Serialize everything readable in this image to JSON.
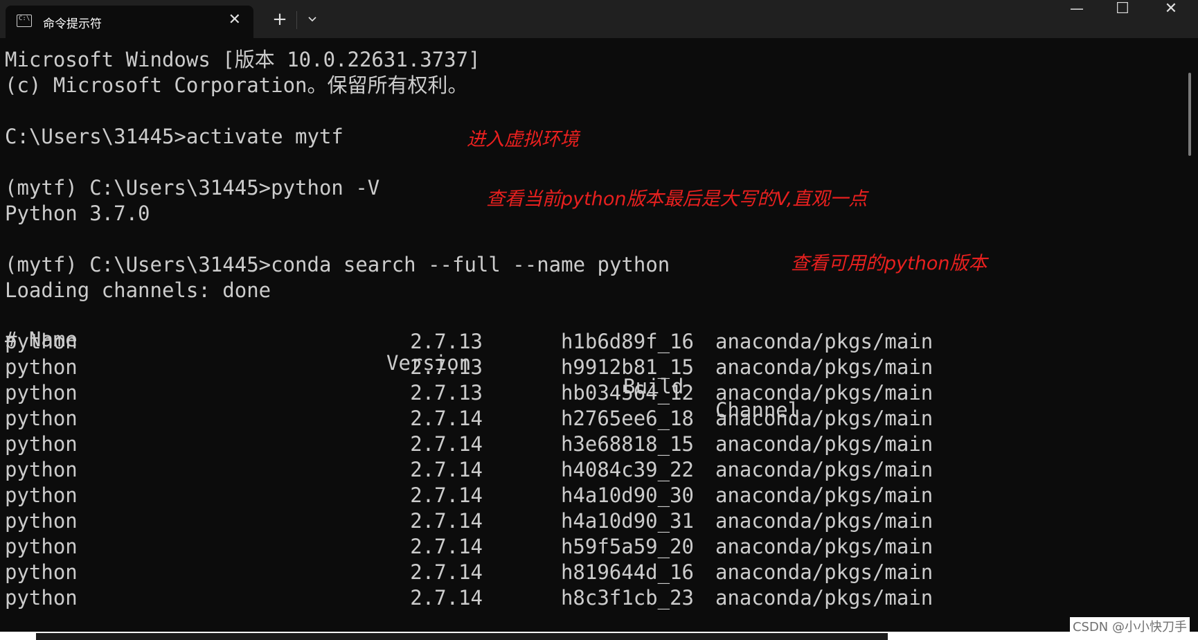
{
  "window": {
    "tab_title": "命令提示符",
    "tab_icon": "cmd-terminal-icon",
    "tab_close": "✕",
    "new_tab": "+",
    "minimize": "—",
    "maximize": "☐",
    "close": "✕"
  },
  "terminal": {
    "lines": [
      "Microsoft Windows [版本 10.0.22631.3737]",
      "(c) Microsoft Corporation。保留所有权利。",
      "",
      "C:\\Users\\31445>activate mytf",
      "",
      "(mytf) C:\\Users\\31445>python -V",
      "Python 3.7.0",
      "",
      "(mytf) C:\\Users\\31445>conda search --full --name python",
      "Loading channels: done"
    ],
    "table_header": {
      "name": "# Name",
      "version": "Version",
      "build": "Build",
      "channel": "Channel"
    },
    "table_rows": [
      {
        "name": "python",
        "version": "2.7.13",
        "build": "h1b6d89f_16",
        "channel": "anaconda/pkgs/main"
      },
      {
        "name": "python",
        "version": "2.7.13",
        "build": "h9912b81_15",
        "channel": "anaconda/pkgs/main"
      },
      {
        "name": "python",
        "version": "2.7.13",
        "build": "hb034564_12",
        "channel": "anaconda/pkgs/main"
      },
      {
        "name": "python",
        "version": "2.7.14",
        "build": "h2765ee6_18",
        "channel": "anaconda/pkgs/main"
      },
      {
        "name": "python",
        "version": "2.7.14",
        "build": "h3e68818_15",
        "channel": "anaconda/pkgs/main"
      },
      {
        "name": "python",
        "version": "2.7.14",
        "build": "h4084c39_22",
        "channel": "anaconda/pkgs/main"
      },
      {
        "name": "python",
        "version": "2.7.14",
        "build": "h4a10d90_30",
        "channel": "anaconda/pkgs/main"
      },
      {
        "name": "python",
        "version": "2.7.14",
        "build": "h4a10d90_31",
        "channel": "anaconda/pkgs/main"
      },
      {
        "name": "python",
        "version": "2.7.14",
        "build": "h59f5a59_20",
        "channel": "anaconda/pkgs/main"
      },
      {
        "name": "python",
        "version": "2.7.14",
        "build": "h819644d_16",
        "channel": "anaconda/pkgs/main"
      },
      {
        "name": "python",
        "version": "2.7.14",
        "build": "h8c3f1cb_23",
        "channel": "anaconda/pkgs/main"
      }
    ]
  },
  "annotations": {
    "activate": "进入虚拟环境",
    "version": "查看当前python版本最后是大写的V,直观一点",
    "search": "查看可用的python版本"
  },
  "watermark": "CSDN @小小快刀手",
  "colors": {
    "terminal_bg": "#0c0c0c",
    "text": "#cccccc",
    "annotation": "#e8201f",
    "titlebar": "#202020"
  }
}
